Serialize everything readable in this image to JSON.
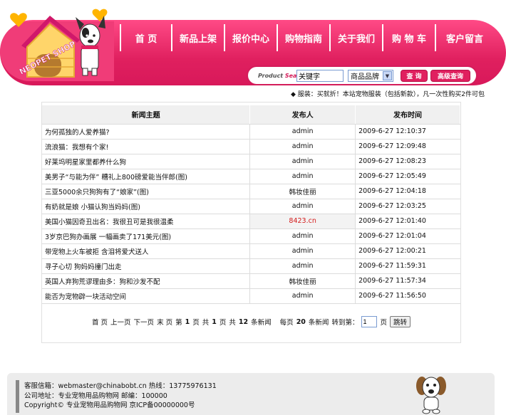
{
  "header": {
    "logo_text": "NEOPET SHOP",
    "nav": [
      "首 页",
      "新品上架",
      "报价中心",
      "购物指南",
      "关于我们",
      "购 物 车",
      "客户留言"
    ],
    "search": {
      "label_prefix": "Product",
      "label_word": "Search",
      "input_value": "关键字",
      "select_value": "商品品牌",
      "search_button": "查 询",
      "advanced_button": "高级查询"
    },
    "notice": "◆ 服装：买就折！本站宠物服装（包括新款），凡一次性购买2件可包"
  },
  "news": {
    "columns": [
      "新闻主题",
      "发布人",
      "发布时间"
    ],
    "rows": [
      {
        "title": "为何孤独的人爱养猫?",
        "author": "admin",
        "time": "2009-6-27 12:10:37"
      },
      {
        "title": "流浪猫：我想有个家!",
        "author": "admin",
        "time": "2009-6-27 12:09:48"
      },
      {
        "title": "好莱坞明星家里都养什么狗",
        "author": "admin",
        "time": "2009-6-27 12:08:23"
      },
      {
        "title": "美男子“与能为伴” 糟礼上800磅爱能当伴郎(图)",
        "author": "admin",
        "time": "2009-6-27 12:05:49"
      },
      {
        "title": "三亚5000余只狗狗有了“娘家”(图)",
        "author": "韩妆佳丽",
        "time": "2009-6-27 12:04:18"
      },
      {
        "title": "有奶就是娘 小猫认狗当妈妈(图)",
        "author": "admin",
        "time": "2009-6-27 12:03:25"
      },
      {
        "title": "美国小猫因奇丑出名：我很丑可是我很温柔",
        "author": "8423.cn",
        "time": "2009-6-27 12:01:40"
      },
      {
        "title": "3岁京巴狗办画展 一幅画卖了171美元(图)",
        "author": "admin",
        "time": "2009-6-27 12:01:04"
      },
      {
        "title": "带宠物上火车被拒 含泪将爱犬送人",
        "author": "admin",
        "time": "2009-6-27 12:00:21"
      },
      {
        "title": "寻子心切 狗妈妈撞门出走",
        "author": "admin",
        "time": "2009-6-27 11:59:31"
      },
      {
        "title": "英国人弃狗荒谬理由多：狗和沙发不配",
        "author": "韩妆佳丽",
        "time": "2009-6-27 11:57:34"
      },
      {
        "title": "能否为宠物辟一块活动空间",
        "author": "admin",
        "time": "2009-6-27 11:56:50"
      }
    ],
    "pager": {
      "first": "首 页",
      "prev": "上一页",
      "next": "下一页",
      "last": "末 页",
      "page_prefix": "第",
      "current_page": "1",
      "page_suffix": "页",
      "total_prefix": "共",
      "total_pages": "1",
      "total_suffix": "页",
      "count_prefix": "共",
      "count": "12",
      "count_suffix": "条新闻",
      "per_page_prefix": "每页",
      "per_page": "20",
      "per_page_suffix": "条新闻",
      "goto_label": "转到第：",
      "goto_value": "1",
      "goto_suffix": "页",
      "goto_button": "跳转"
    }
  },
  "footer": {
    "line1": "客服信箱：webmaster@chinabobt.cn  热线：13775976131",
    "line2": "公司地址：专业宠物用品购物网  邮编：100000",
    "line3": "Copyright© 专业宠物用品购物网  京ICP备00000000号"
  },
  "colors": {
    "brand_pink": "#e0205f",
    "highlight_red": "#d41c1c"
  }
}
